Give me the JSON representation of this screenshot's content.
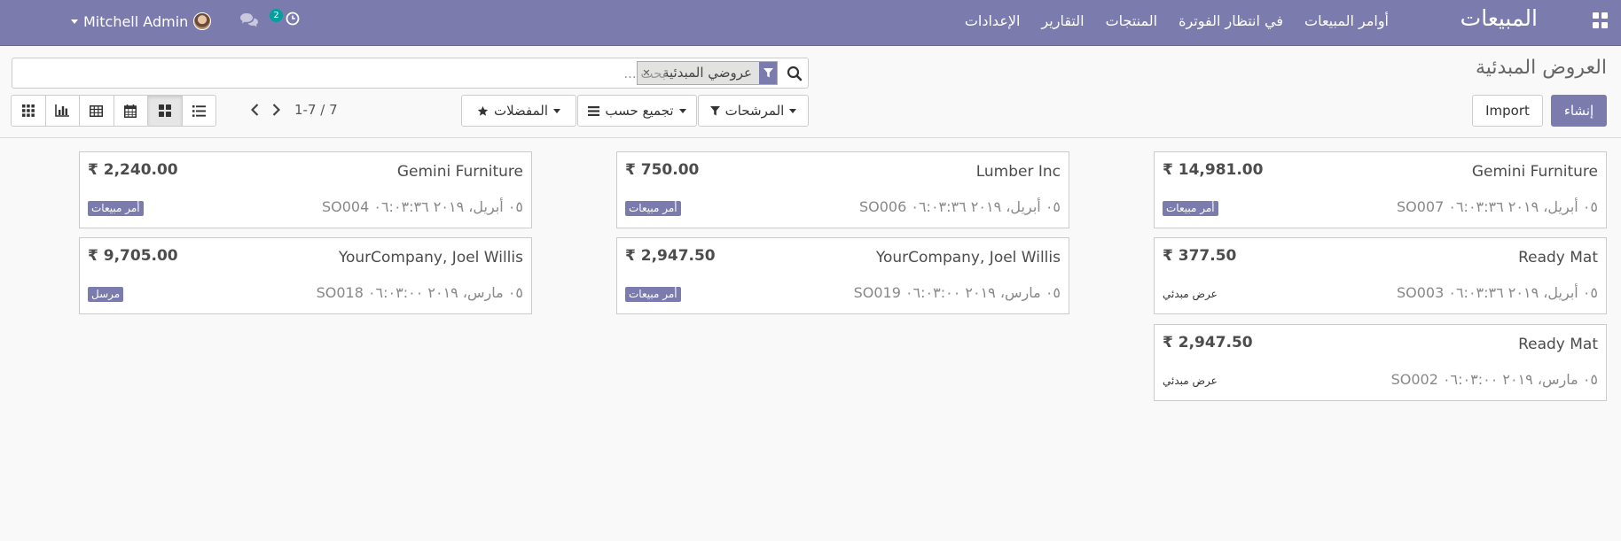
{
  "nav": {
    "brand": "المبيعات",
    "menu": [
      "أوامر المبيعات",
      "في انتظار الفوترة",
      "المنتجات",
      "التقارير",
      "الإعدادات"
    ],
    "user_name": "Mitchell Admin",
    "activity_count": "2"
  },
  "control_panel": {
    "breadcrumb": "العروض المبدئية",
    "search": {
      "facet": "عروضي المبدئية",
      "placeholder": "بحث ..."
    },
    "buttons": {
      "create": "إنشاء",
      "import": "Import",
      "filters": "المرشحات",
      "group_by": "تجميع حسب",
      "favorites": "المفضلات"
    },
    "pager": "1-7 / 7",
    "views": [
      "kanban-view",
      "list-view",
      "calendar-view",
      "pivot-view",
      "graph-view",
      "activity-view"
    ]
  },
  "kanban": {
    "cards": [
      {
        "partner": "Gemini Furniture",
        "amount": "₹ 14,981.00",
        "ref": "SO007 ٠٥ أبريل، ٢٠١٩ ٠٦:٠٣:٣٦",
        "tag": "أمر مبيعات",
        "tag_style": "badge"
      },
      {
        "partner": "Lumber Inc",
        "amount": "₹ 750.00",
        "ref": "SO006 ٠٥ أبريل، ٢٠١٩ ٠٦:٠٣:٣٦",
        "tag": "أمر مبيعات",
        "tag_style": "badge"
      },
      {
        "partner": "Gemini Furniture",
        "amount": "₹ 2,240.00",
        "ref": "SO004 ٠٥ أبريل، ٢٠١٩ ٠٦:٠٣:٣٦",
        "tag": "أمر مبيعات",
        "tag_style": "badge"
      },
      {
        "partner": "Ready Mat",
        "amount": "₹ 377.50",
        "ref": "SO003 ٠٥ أبريل، ٢٠١٩ ٠٦:٠٣:٣٦",
        "tag": "عرض مبدئي",
        "tag_style": "plain"
      },
      {
        "partner": "YourCompany, Joel Willis",
        "amount": "₹ 2,947.50",
        "ref": "SO019 ٠٥ مارس، ٢٠١٩ ٠٦:٠٣:٠٠",
        "tag": "أمر مبيعات",
        "tag_style": "badge"
      },
      {
        "partner": "YourCompany, Joel Willis",
        "amount": "₹ 9,705.00",
        "ref": "SO018 ٠٥ مارس، ٢٠١٩ ٠٦:٠٣:٠٠",
        "tag": "مرسل",
        "tag_style": "badge"
      },
      {
        "partner": "Ready Mat",
        "amount": "₹ 2,947.50",
        "ref": "SO002 ٠٥ مارس، ٢٠١٩ ٠٦:٠٣:٠٠",
        "tag": "عرض مبدئي",
        "tag_style": "plain"
      }
    ]
  },
  "colors": {
    "primary": "#7c7bad",
    "badge_green": "#00a09d"
  }
}
